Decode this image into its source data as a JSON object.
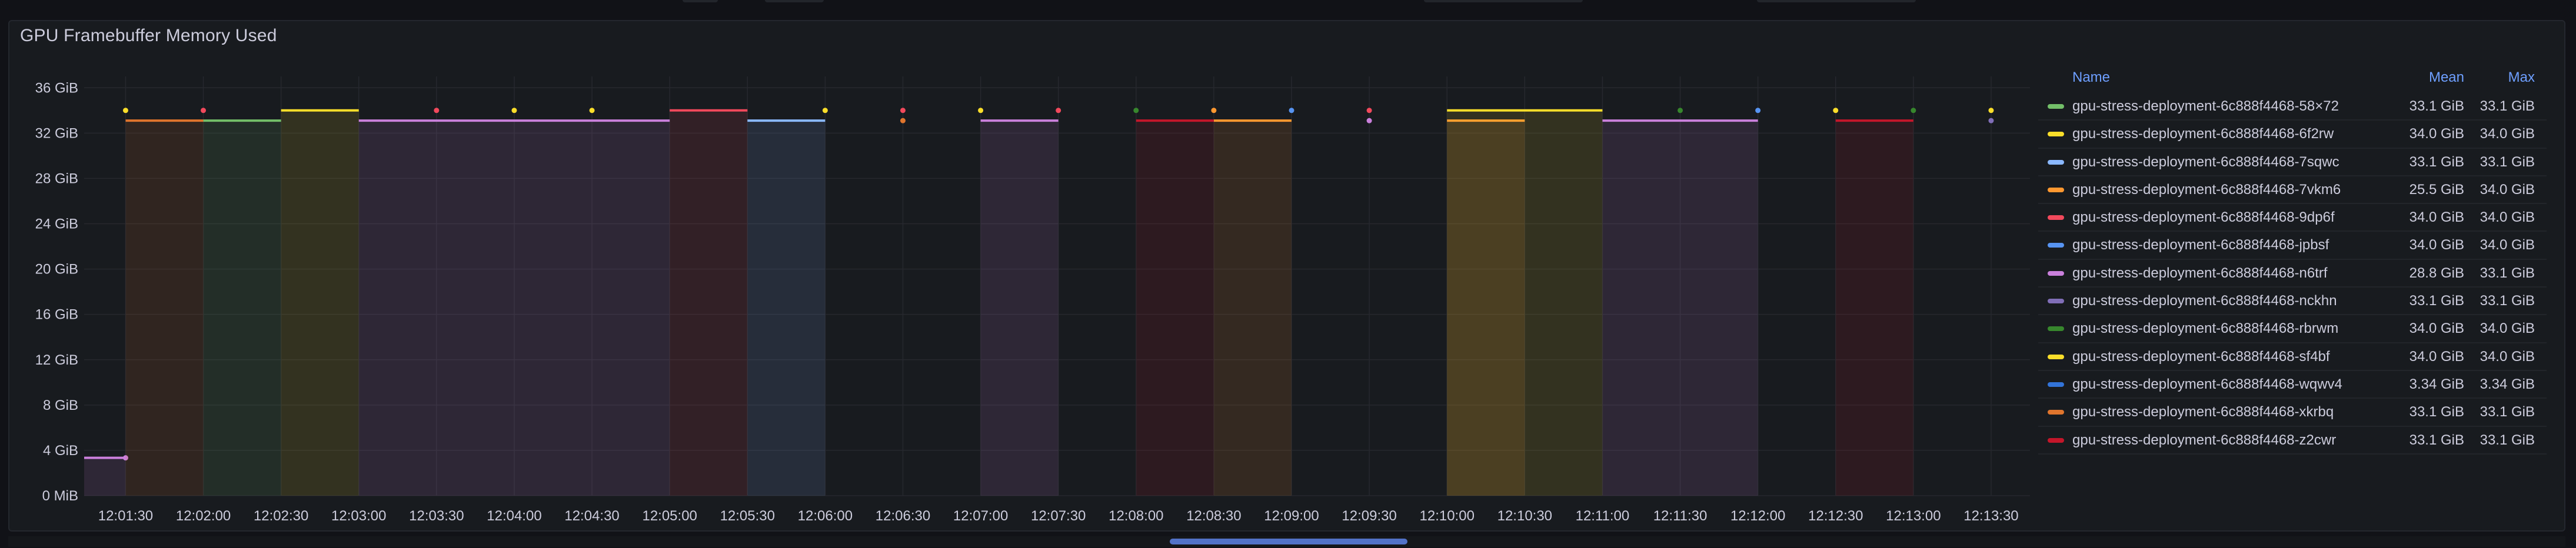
{
  "panel": {
    "title": "GPU Framebuffer Memory Used"
  },
  "legend": {
    "col_name": "Name",
    "col_mean": "Mean",
    "col_max": "Max"
  },
  "colors": {
    "background": "#111217",
    "panel": "#181b1f",
    "grid": "#26282e",
    "axis_text": "#ccccdc",
    "legend_header": "#6e9fff"
  },
  "chart_data": {
    "type": "line",
    "title": "GPU Framebuffer Memory Used",
    "y_ticks": [
      "0 MiB",
      "4 GiB",
      "8 GiB",
      "12 GiB",
      "16 GiB",
      "20 GiB",
      "24 GiB",
      "28 GiB",
      "32 GiB",
      "36 GiB"
    ],
    "x_ticks": [
      "12:01:30",
      "12:02:00",
      "12:02:30",
      "12:03:00",
      "12:03:30",
      "12:04:00",
      "12:04:30",
      "12:05:00",
      "12:05:30",
      "12:06:00",
      "12:06:30",
      "12:07:00",
      "12:07:30",
      "12:08:00",
      "12:08:30",
      "12:09:00",
      "12:09:30",
      "12:10:00",
      "12:10:30",
      "12:11:00",
      "12:11:30",
      "12:12:00",
      "12:12:30",
      "12:13:00",
      "12:13:30"
    ],
    "x_range": [
      "12:01:14",
      "12:13:45"
    ],
    "y_range_gib": [
      0,
      37
    ],
    "grid": true,
    "legend_position": "right",
    "series": [
      {
        "name": "gpu-stress-deployment-6c888f4468-58×72",
        "color": "#73bf69",
        "mean": "33.1 GiB",
        "max": "33.1 GiB",
        "segments": [
          {
            "start": "12:02:00",
            "end": "12:02:30",
            "value_gib": 33.1
          }
        ],
        "points": []
      },
      {
        "name": "gpu-stress-deployment-6c888f4468-6f2rw",
        "color": "#fade2a",
        "mean": "34.0 GiB",
        "max": "34.0 GiB",
        "segments": [
          {
            "start": "12:02:30",
            "end": "12:03:00",
            "value_gib": 34.0
          }
        ],
        "points": [
          {
            "t": "12:01:30",
            "value_gib": 34.0
          },
          {
            "t": "12:04:00",
            "value_gib": 34.0
          },
          {
            "t": "12:04:30",
            "value_gib": 34.0
          },
          {
            "t": "12:06:00",
            "value_gib": 34.0
          },
          {
            "t": "12:07:00",
            "value_gib": 34.0
          },
          {
            "t": "12:12:30",
            "value_gib": 34.0
          },
          {
            "t": "12:13:30",
            "value_gib": 34.0
          }
        ]
      },
      {
        "name": "gpu-stress-deployment-6c888f4468-7sqwc",
        "color": "#8ab8ff",
        "mean": "33.1 GiB",
        "max": "33.1 GiB",
        "segments": [
          {
            "start": "12:05:30",
            "end": "12:06:00",
            "value_gib": 33.1
          }
        ],
        "points": []
      },
      {
        "name": "gpu-stress-deployment-6c888f4468-7vkm6",
        "color": "#ff9830",
        "mean": "25.5 GiB",
        "max": "34.0 GiB",
        "segments": [
          {
            "start": "12:08:30",
            "end": "12:09:00",
            "value_gib": 33.1
          },
          {
            "start": "12:10:00",
            "end": "12:10:30",
            "value_gib": 33.1
          }
        ],
        "points": [
          {
            "t": "12:08:30",
            "value_gib": 34.0
          }
        ]
      },
      {
        "name": "gpu-stress-deployment-6c888f4468-9dp6f",
        "color": "#f2495c",
        "mean": "34.0 GiB",
        "max": "34.0 GiB",
        "segments": [
          {
            "start": "12:05:00",
            "end": "12:05:30",
            "value_gib": 34.0
          }
        ],
        "points": [
          {
            "t": "12:02:00",
            "value_gib": 34.0
          },
          {
            "t": "12:03:30",
            "value_gib": 34.0
          },
          {
            "t": "12:06:30",
            "value_gib": 34.0
          },
          {
            "t": "12:07:30",
            "value_gib": 34.0
          },
          {
            "t": "12:09:30",
            "value_gib": 34.0
          }
        ]
      },
      {
        "name": "gpu-stress-deployment-6c888f4468-jpbsf",
        "color": "#5794f2",
        "mean": "34.0 GiB",
        "max": "34.0 GiB",
        "segments": [],
        "points": [
          {
            "t": "12:09:00",
            "value_gib": 34.0
          },
          {
            "t": "12:12:00",
            "value_gib": 34.0
          }
        ]
      },
      {
        "name": "gpu-stress-deployment-6c888f4468-n6trf",
        "color": "#ca80dc",
        "mean": "28.8 GiB",
        "max": "33.1 GiB",
        "segments": [
          {
            "start": "12:01:14",
            "end": "12:01:30",
            "value_gib": 3.34
          },
          {
            "start": "12:03:00",
            "end": "12:05:00",
            "value_gib": 33.1
          },
          {
            "start": "12:07:00",
            "end": "12:07:30",
            "value_gib": 33.1
          },
          {
            "start": "12:11:00",
            "end": "12:12:00",
            "value_gib": 33.1
          }
        ],
        "points": [
          {
            "t": "12:01:30",
            "value_gib": 3.34
          },
          {
            "t": "12:09:30",
            "value_gib": 33.1
          }
        ]
      },
      {
        "name": "gpu-stress-deployment-6c888f4468-nckhn",
        "color": "#806eb7",
        "mean": "33.1 GiB",
        "max": "33.1 GiB",
        "segments": [],
        "points": [
          {
            "t": "12:13:30",
            "value_gib": 33.1
          }
        ]
      },
      {
        "name": "gpu-stress-deployment-6c888f4468-rbrwm",
        "color": "#37872d",
        "mean": "34.0 GiB",
        "max": "34.0 GiB",
        "segments": [],
        "points": [
          {
            "t": "12:08:00",
            "value_gib": 34.0
          },
          {
            "t": "12:11:30",
            "value_gib": 34.0
          },
          {
            "t": "12:13:00",
            "value_gib": 34.0
          }
        ]
      },
      {
        "name": "gpu-stress-deployment-6c888f4468-sf4bf",
        "color": "#fade2a",
        "mean": "34.0 GiB",
        "max": "34.0 GiB",
        "segments": [
          {
            "start": "12:10:00",
            "end": "12:11:00",
            "value_gib": 34.0
          }
        ],
        "points": []
      },
      {
        "name": "gpu-stress-deployment-6c888f4468-wqwv4",
        "color": "#3274d9",
        "mean": "3.34 GiB",
        "max": "3.34 GiB",
        "segments": [],
        "points": []
      },
      {
        "name": "gpu-stress-deployment-6c888f4468-xkrbq",
        "color": "#e0752d",
        "mean": "33.1 GiB",
        "max": "33.1 GiB",
        "segments": [
          {
            "start": "12:01:30",
            "end": "12:02:00",
            "value_gib": 33.1
          }
        ],
        "points": [
          {
            "t": "12:06:30",
            "value_gib": 33.1
          }
        ]
      },
      {
        "name": "gpu-stress-deployment-6c888f4468-z2cwr",
        "color": "#c4162a",
        "mean": "33.1 GiB",
        "max": "33.1 GiB",
        "segments": [
          {
            "start": "12:08:00",
            "end": "12:08:30",
            "value_gib": 33.1
          },
          {
            "start": "12:12:30",
            "end": "12:13:00",
            "value_gib": 33.1
          }
        ],
        "points": []
      }
    ]
  }
}
